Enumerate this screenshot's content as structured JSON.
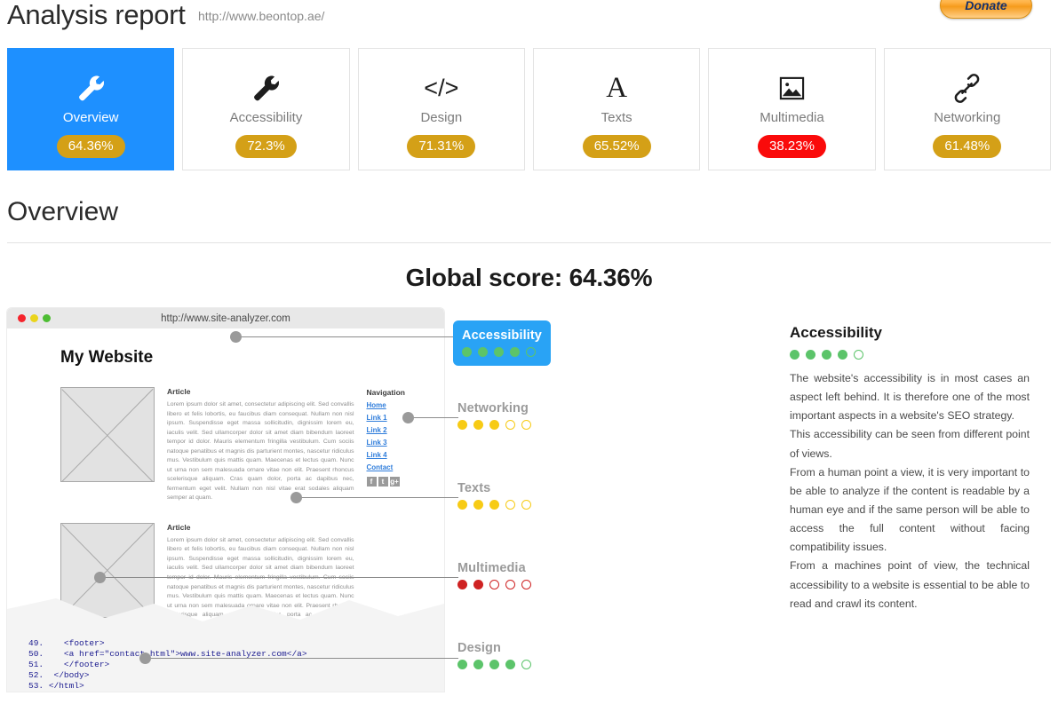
{
  "header": {
    "title": "Analysis report",
    "url": "http://www.beontop.ae/",
    "donate_label": "Donate"
  },
  "tabs": [
    {
      "label": "Overview",
      "score": "64.36%",
      "icon": "wrench-icon",
      "active": true,
      "score_color": "#d4a017"
    },
    {
      "label": "Accessibility",
      "score": "72.3%",
      "icon": "wrench-icon",
      "active": false,
      "score_color": "#d4a017"
    },
    {
      "label": "Design",
      "score": "71.31%",
      "icon": "code-icon",
      "active": false,
      "score_color": "#d4a017"
    },
    {
      "label": "Texts",
      "score": "65.52%",
      "icon": "serif-a-icon",
      "active": false,
      "score_color": "#d4a017"
    },
    {
      "label": "Multimedia",
      "score": "38.23%",
      "icon": "image-icon",
      "active": false,
      "score_color": "#fa0a0a"
    },
    {
      "label": "Networking",
      "score": "61.48%",
      "icon": "link-chain-icon",
      "active": false,
      "score_color": "#d4a017"
    }
  ],
  "section": {
    "title": "Overview",
    "global_score": "Global score: 64.36%"
  },
  "browser": {
    "url": "http://www.site-analyzer.com",
    "heading": "My Website",
    "article_title": "Article",
    "article_text": "Lorem ipsum dolor sit amet, consectetur adipiscing elit. Sed convallis libero et felis lobortis, eu faucibus diam consequat. Nullam non nisl ipsum. Suspendisse eget massa sollicitudin, dignissim lorem eu, iaculis velit. Sed ullamcorper dolor sit amet diam bibendum laoreet tempor id dolor. Mauris elementum fringilla vestibulum. Cum sociis natoque penatibus et magnis dis parturient montes, nascetur ridiculus mus. Vestibulum quis mattis quam. Maecenas et lectus quam. Nunc ut urna non sem malesuada ornare vitae non elit. Praesent rhoncus scelerisque aliquam. Cras quam dolor, porta ac dapibus nec, fermentum eget velit. Nullam non nisl vitae erat sodales aliquam semper at quam.",
    "nav_title": "Navigation",
    "nav_links": [
      "Home",
      "Link 1",
      "Link 2",
      "Link 3",
      "Link 4",
      "Contact"
    ],
    "social": [
      "f",
      "t",
      "g+"
    ],
    "code_lines": [
      {
        "num": "49.",
        "indent": "    ",
        "text": "<footer>"
      },
      {
        "num": "50.",
        "indent": "    ",
        "text": "<a href=\"contact.html\">www.site-analyzer.com</a>"
      },
      {
        "num": "51.",
        "indent": "    ",
        "text": "</footer>"
      },
      {
        "num": "52.",
        "indent": "  ",
        "text": "</body>"
      },
      {
        "num": "53.",
        "indent": " ",
        "text": "</html>"
      }
    ]
  },
  "annotations": [
    {
      "label": "Accessibility",
      "filled": 4,
      "total": 5,
      "color": "green",
      "highlighted": true
    },
    {
      "label": "Networking",
      "filled": 3,
      "total": 5,
      "color": "yellow",
      "highlighted": false
    },
    {
      "label": "Texts",
      "filled": 3,
      "total": 5,
      "color": "yellow",
      "highlighted": false
    },
    {
      "label": "Multimedia",
      "filled": 2,
      "total": 5,
      "color": "red",
      "highlighted": false
    },
    {
      "label": "Design",
      "filled": 4,
      "total": 5,
      "color": "green",
      "highlighted": false
    }
  ],
  "description": {
    "title": "Accessibility",
    "filled": 4,
    "total": 5,
    "color": "green",
    "paragraphs": [
      "The website's accessibility is in most cases an aspect left behind. It is therefore one of the most important aspects in a website's SEO strategy.",
      "This accessibility can be seen from different point of views.",
      "From a human point a view, it is very important to be able to analyze if the content is readable by a human eye and if the same person will be able to access the full content without facing compatibility issues.",
      "From a machines point of view, the technical accessibility to a website is essential to be able to read and crawl its content."
    ]
  }
}
